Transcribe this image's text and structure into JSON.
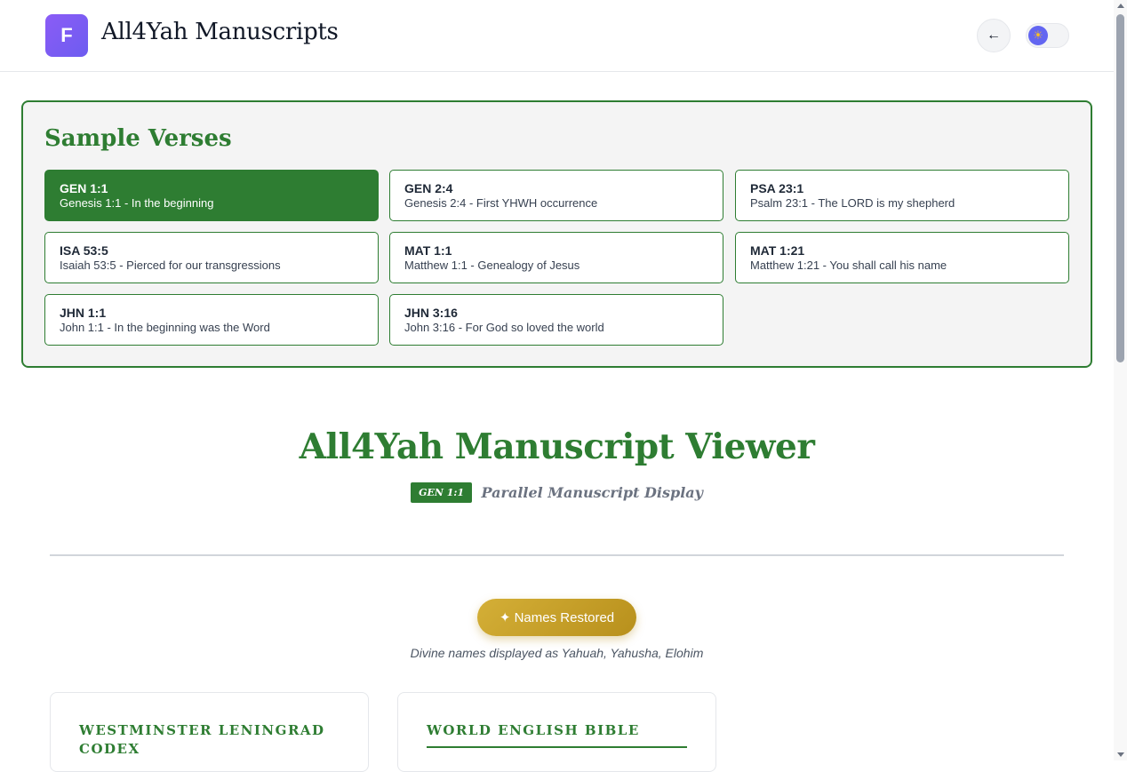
{
  "header": {
    "logo_letter": "F",
    "title": "All4Yah Manuscripts",
    "back_label": "←",
    "theme_icon": "☀"
  },
  "samples": {
    "title": "Sample Verses",
    "items": [
      {
        "ref": "GEN 1:1",
        "desc": "Genesis 1:1 - In the beginning",
        "active": true
      },
      {
        "ref": "GEN 2:4",
        "desc": "Genesis 2:4 - First YHWH occurrence",
        "active": false
      },
      {
        "ref": "PSA 23:1",
        "desc": "Psalm 23:1 - The LORD is my shepherd",
        "active": false
      },
      {
        "ref": "ISA 53:5",
        "desc": "Isaiah 53:5 - Pierced for our transgressions",
        "active": false
      },
      {
        "ref": "MAT 1:1",
        "desc": "Matthew 1:1 - Genealogy of Jesus",
        "active": false
      },
      {
        "ref": "MAT 1:21",
        "desc": "Matthew 1:21 - You shall call his name",
        "active": false
      },
      {
        "ref": "JHN 1:1",
        "desc": "John 1:1 - In the beginning was the Word",
        "active": false
      },
      {
        "ref": "JHN 3:16",
        "desc": "John 3:16 - For God so loved the world",
        "active": false
      }
    ]
  },
  "viewer": {
    "title": "All4Yah Manuscript Viewer",
    "ref_badge": "GEN 1:1",
    "subtitle": "Parallel Manuscript Display",
    "names_button": "✦ Names Restored",
    "names_note": "Divine names displayed as Yahuah, Yahusha, Elohim"
  },
  "manuscripts": [
    {
      "title": "WESTMINSTER LENINGRAD CODEX"
    },
    {
      "title": "WORLD ENGLISH BIBLE"
    }
  ],
  "colors": {
    "accent": "#2e7d32",
    "gold": "#d4af37",
    "logo": "#7c5cf3"
  }
}
